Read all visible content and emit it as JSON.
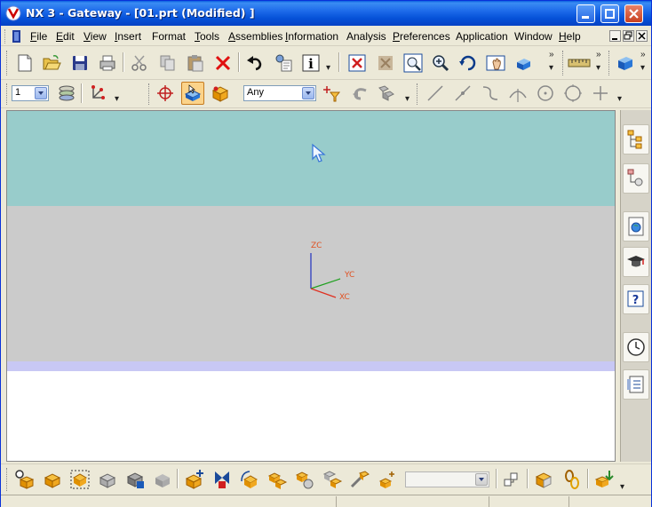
{
  "window": {
    "title": "NX 3 - Gateway - [01.prt (Modified) ]"
  },
  "menubar": {
    "items": [
      {
        "key": "F",
        "rest": "ile"
      },
      {
        "key": "E",
        "rest": "dit"
      },
      {
        "key": "V",
        "rest": "iew"
      },
      {
        "key": "I",
        "rest": "nsert"
      },
      {
        "key": "",
        "rest": "Format"
      },
      {
        "key": "T",
        "rest": "ools"
      },
      {
        "key": "A",
        "rest": "ssemblies"
      },
      {
        "key": "I",
        "rest": "nformation"
      },
      {
        "key": "",
        "rest": "Analysis"
      },
      {
        "key": "P",
        "rest": "references"
      },
      {
        "key": "",
        "rest": "Application"
      },
      {
        "key": "",
        "rest": "Window"
      },
      {
        "key": "H",
        "rest": "elp"
      }
    ]
  },
  "toolbar_standard": {
    "icons": [
      "new-icon",
      "open-icon",
      "save-icon",
      "print-icon",
      "cut-icon",
      "copy-icon",
      "paste-icon",
      "delete-icon",
      "undo-icon",
      "properties-icon",
      "information-icon",
      "fit-icon",
      "refresh-icon",
      "zoom-window-icon",
      "zoom-icon",
      "rotate-icon",
      "pan-icon",
      "shaded-icon",
      "measure-icon",
      "display-mode-icon"
    ]
  },
  "toolbar_selection": {
    "layer_value": "1",
    "filter_value": "Any"
  },
  "viewport": {
    "triad": {
      "z_label": "ZC",
      "y_label": "YC",
      "x_label": "XC"
    },
    "colors": {
      "top": "#98cccb",
      "mid": "#cbcbcb",
      "band": "#c8c8f4",
      "bottom": "#ffffff",
      "x_axis": "#e03020",
      "y_axis": "#20a020",
      "z_axis": "#2030c0"
    }
  },
  "resource_bar": {
    "icons": [
      "assembly-navigator-icon",
      "part-navigator-icon",
      "web-browser-icon",
      "training-icon",
      "help-icon",
      "history-icon",
      "system-palette-icon"
    ]
  },
  "toolbar_assemblies": {
    "selection_value": ""
  },
  "status": {
    "message": ""
  }
}
